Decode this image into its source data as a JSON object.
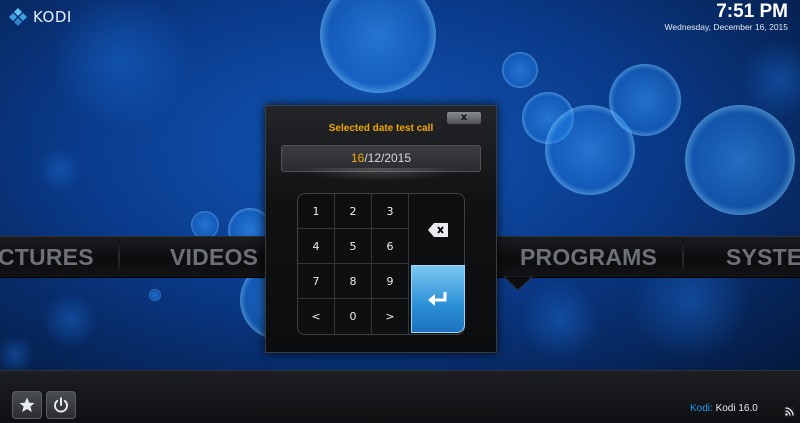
{
  "app": {
    "logo_text": "KODI",
    "logo_icon": "kodi-logo-icon"
  },
  "clock": {
    "time": "7:51 PM",
    "date": "Wednesday, December 16, 2015"
  },
  "menu": {
    "items": [
      "CTURES",
      "VIDEOS",
      "PROGRAMS",
      "SYSTE"
    ]
  },
  "dialog": {
    "title": "Selected date test call",
    "close_label": "x",
    "date_day": "16",
    "date_rest": "/12/2015"
  },
  "keypad": {
    "keys": [
      "1",
      "2",
      "3",
      "4",
      "5",
      "6",
      "7",
      "8",
      "9",
      "<",
      "0",
      ">"
    ],
    "backspace_icon": "backspace-icon",
    "enter_icon": "enter-icon"
  },
  "footer": {
    "brand": "Kodi:",
    "version": "Kodi 16.0",
    "favourites_icon": "star-icon",
    "power_icon": "power-icon",
    "rss_icon": "rss-icon"
  },
  "colors": {
    "accent_orange": "#f0a800",
    "accent_blue": "#1f9cf0",
    "background": "#03163a"
  }
}
